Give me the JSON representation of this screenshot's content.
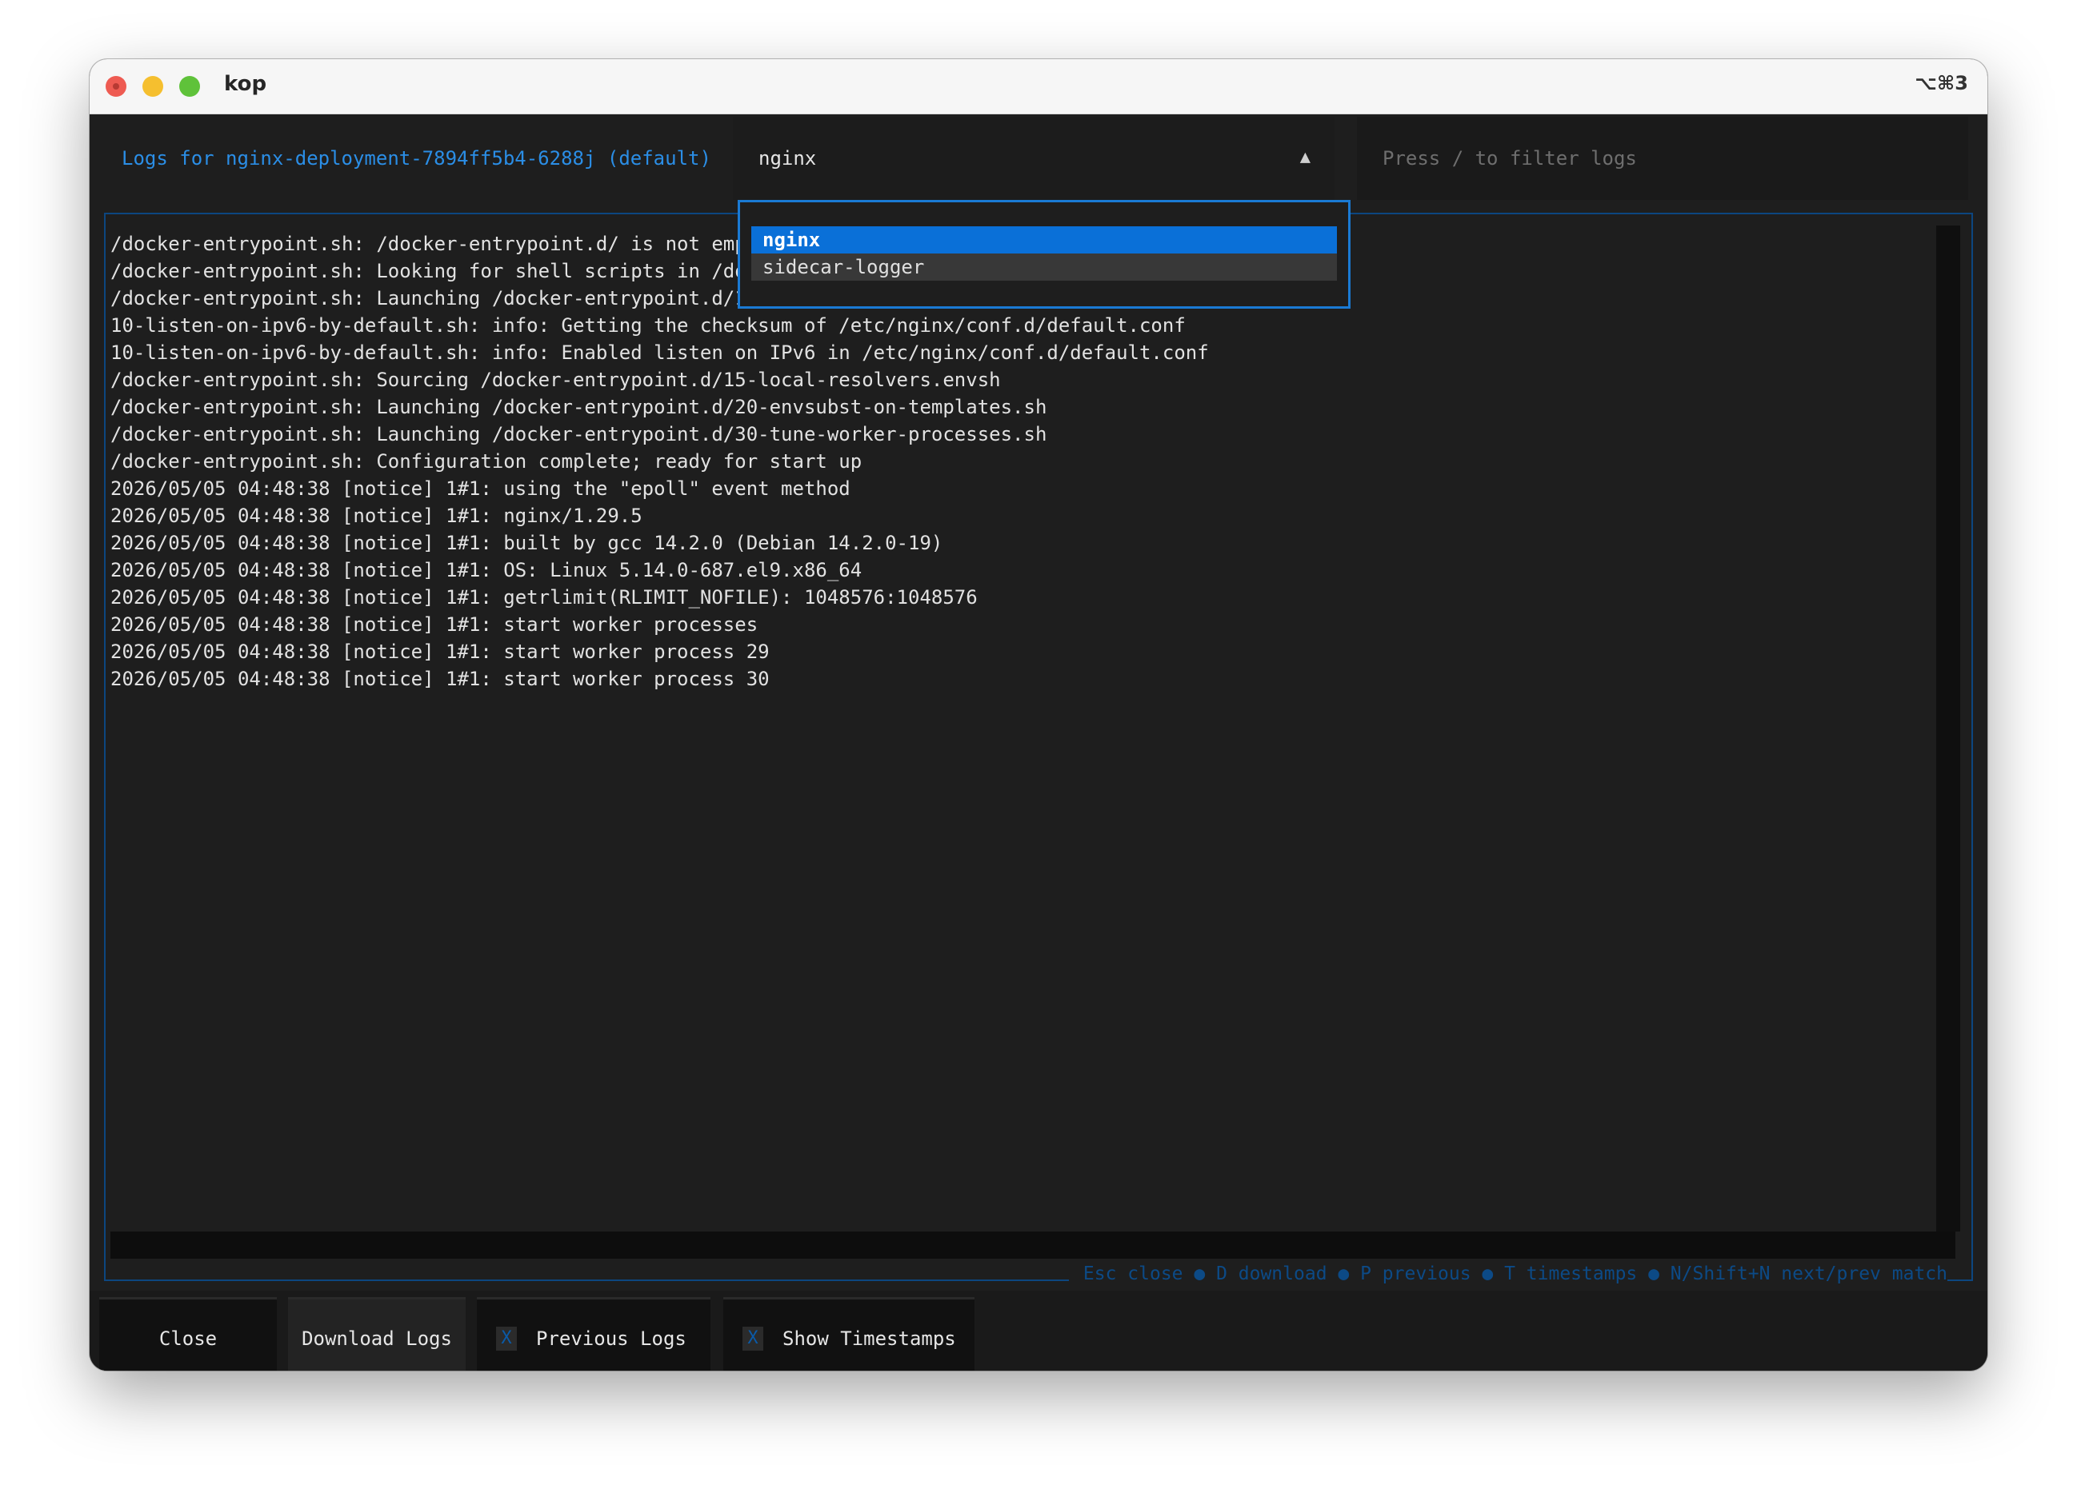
{
  "window": {
    "title": "kop",
    "shortcut": "⌥⌘3"
  },
  "header": {
    "title": "Logs for nginx-deployment-7894ff5b4-6288j (default)",
    "container_select": {
      "value": "nginx",
      "options": [
        "nginx",
        "sidecar-logger"
      ],
      "selected_index": 0
    },
    "filter": {
      "placeholder": "Press / to filter logs",
      "value": ""
    }
  },
  "logs": {
    "lines": [
      "/docker-entrypoint.sh: /docker-entrypoint.d/ is not emp",
      "/docker-entrypoint.sh: Looking for shell scripts in /do",
      "/docker-entrypoint.sh: Launching /docker-entrypoint.d/1",
      "10-listen-on-ipv6-by-default.sh: info: Getting the checksum of /etc/nginx/conf.d/default.conf",
      "10-listen-on-ipv6-by-default.sh: info: Enabled listen on IPv6 in /etc/nginx/conf.d/default.conf",
      "/docker-entrypoint.sh: Sourcing /docker-entrypoint.d/15-local-resolvers.envsh",
      "/docker-entrypoint.sh: Launching /docker-entrypoint.d/20-envsubst-on-templates.sh",
      "/docker-entrypoint.sh: Launching /docker-entrypoint.d/30-tune-worker-processes.sh",
      "/docker-entrypoint.sh: Configuration complete; ready for start up",
      "2026/05/05 04:48:38 [notice] 1#1: using the \"epoll\" event method",
      "2026/05/05 04:48:38 [notice] 1#1: nginx/1.29.5",
      "2026/05/05 04:48:38 [notice] 1#1: built by gcc 14.2.0 (Debian 14.2.0-19)",
      "2026/05/05 04:48:38 [notice] 1#1: OS: Linux 5.14.0-687.el9.x86_64",
      "2026/05/05 04:48:38 [notice] 1#1: getrlimit(RLIMIT_NOFILE): 1048576:1048576",
      "2026/05/05 04:48:38 [notice] 1#1: start worker processes",
      "2026/05/05 04:48:38 [notice] 1#1: start worker process 29",
      "2026/05/05 04:48:38 [notice] 1#1: start worker process 30"
    ],
    "hints": "Esc close ● D download ● P previous ● T timestamps ● N/Shift+N next/prev match"
  },
  "footer": {
    "close_label": "Close",
    "download_label": "Download Logs",
    "previous_label": "Previous Logs",
    "previous_check": "X",
    "timestamps_label": "Show Timestamps",
    "timestamps_check": "X"
  },
  "colors": {
    "accent": "#2b8ee6",
    "selection": "#0a70d8",
    "panel_border": "#0c4680",
    "background": "#1e1e1e"
  },
  "icons": {
    "select_arrow": "triangle-up-icon",
    "checkbox": "checkbox-icon"
  }
}
